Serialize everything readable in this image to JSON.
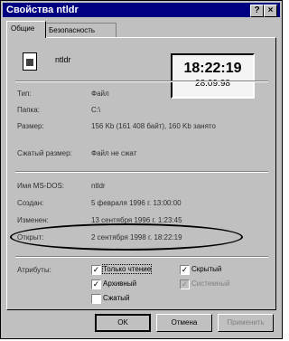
{
  "window": {
    "title": "Свойства ntldr",
    "help": "?",
    "close": "×"
  },
  "tabs": [
    {
      "label": "Общие"
    },
    {
      "label": "Безопасность"
    }
  ],
  "file": {
    "name": "ntldr",
    "icon": "system-file-icon"
  },
  "clock": {
    "time": "18:22:19",
    "date": "28.09.98"
  },
  "props": {
    "type": {
      "label": "Тип:",
      "value": "Файл"
    },
    "folder": {
      "label": "Папка:",
      "value": "C:\\"
    },
    "size": {
      "label": "Размер:",
      "value": "156 Kb (161 408 байт), 160 Kb занято"
    },
    "packed": {
      "label": "Сжатый размер:",
      "value": "Файл не сжат"
    },
    "dosname": {
      "label": "Имя MS-DOS:",
      "value": "ntldr"
    },
    "created": {
      "label": "Создан:",
      "value": "5 февраля 1996 г. 13:00:00"
    },
    "modified": {
      "label": "Изменен:",
      "value": "13 сентября 1996 г. 1:23:45"
    },
    "opened": {
      "label": "Открыт:",
      "value": "2 сентября 1998 г. 18:22:19"
    }
  },
  "attributes": {
    "label": "Атрибуты:",
    "readonly": {
      "label": "Только чтение",
      "checked": "✓"
    },
    "archive": {
      "label": "Архивный",
      "checked": "✓"
    },
    "packed": {
      "label": "Сжатый",
      "checked": ""
    },
    "hidden": {
      "label": "Скрытый",
      "checked": "✓"
    },
    "system": {
      "label": "Системный",
      "checked": "✓"
    }
  },
  "buttons": {
    "ok": "OK",
    "cancel": "Отмена",
    "apply": "Применить"
  }
}
